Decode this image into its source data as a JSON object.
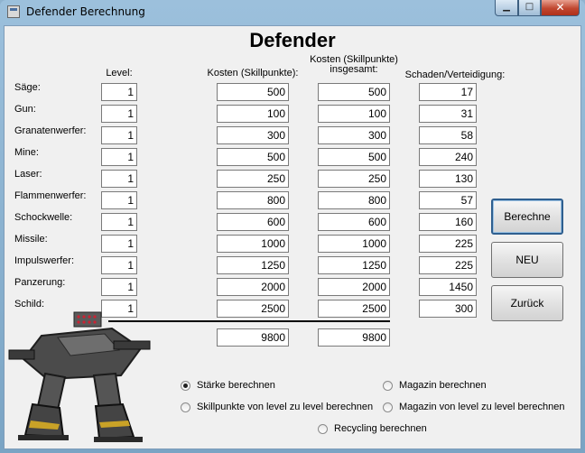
{
  "window": {
    "title": "Defender Berechnung",
    "minimize_glyph": "▁",
    "maximize_glyph": "□",
    "close_glyph": "✕"
  },
  "heading": "Defender",
  "columns": {
    "level": "Level:",
    "kosten": "Kosten (Skillpunkte):",
    "kosten_ges_line1": "Kosten (Skillpunkte)",
    "kosten_ges_line2": "insgesamt:",
    "schaden": "Schaden/Verteidigung:"
  },
  "rows": [
    {
      "label": "Säge:",
      "level": "1",
      "kosten": "500",
      "gesamt": "500",
      "schaden": "17"
    },
    {
      "label": "Gun:",
      "level": "1",
      "kosten": "100",
      "gesamt": "100",
      "schaden": "31"
    },
    {
      "label": "Granatenwerfer:",
      "level": "1",
      "kosten": "300",
      "gesamt": "300",
      "schaden": "58"
    },
    {
      "label": "Mine:",
      "level": "1",
      "kosten": "500",
      "gesamt": "500",
      "schaden": "240"
    },
    {
      "label": "Laser:",
      "level": "1",
      "kosten": "250",
      "gesamt": "250",
      "schaden": "130"
    },
    {
      "label": "Flammenwerfer:",
      "level": "1",
      "kosten": "800",
      "gesamt": "800",
      "schaden": "57"
    },
    {
      "label": "Schockwelle:",
      "level": "1",
      "kosten": "600",
      "gesamt": "600",
      "schaden": "160"
    },
    {
      "label": "Missile:",
      "level": "1",
      "kosten": "1000",
      "gesamt": "1000",
      "schaden": "225"
    },
    {
      "label": "Impulswerfer:",
      "level": "1",
      "kosten": "1250",
      "gesamt": "1250",
      "schaden": "225"
    },
    {
      "label": "Panzerung:",
      "level": "1",
      "kosten": "2000",
      "gesamt": "2000",
      "schaden": "1450"
    },
    {
      "label": "Schild:",
      "level": "1",
      "kosten": "2500",
      "gesamt": "2500",
      "schaden": "300"
    }
  ],
  "totals": {
    "kosten": "9800",
    "gesamt": "9800"
  },
  "buttons": {
    "berechne": "Berechne",
    "neu": "NEU",
    "zurueck": "Zurück"
  },
  "radios": {
    "staerke": {
      "label": "Stärke berechnen",
      "checked": true
    },
    "skill_level": {
      "label": "Skillpunkte von level zu level berechnen",
      "checked": false
    },
    "magazin": {
      "label": "Magazin berechnen",
      "checked": false
    },
    "magazin_level": {
      "label": "Magazin von level zu level berechnen",
      "checked": false
    },
    "recycling": {
      "label": "Recycling berechnen",
      "checked": false
    }
  },
  "image": {
    "icon": "defender-mech-image"
  }
}
